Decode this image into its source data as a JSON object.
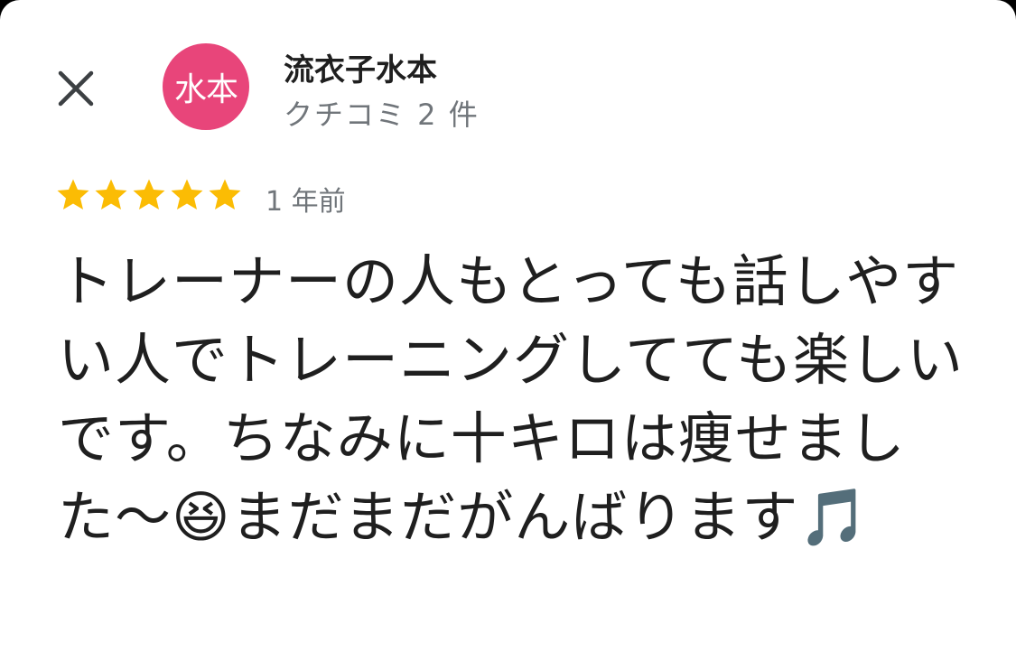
{
  "reviewer": {
    "name": "流衣子水本",
    "avatar_text": "水本",
    "review_count": "クチコミ 2 件",
    "avatar_color": "#e8457a"
  },
  "review": {
    "rating": 5,
    "max_rating": 5,
    "time": "1 年前",
    "text": "トレーナーの人もとっても話しやすい人でトレーニングしてても楽しいです。ちなみに十キロは痩せました〜😆まだまだがんばります🎵"
  },
  "colors": {
    "star": "#fbbc04",
    "secondary_text": "#70757a"
  },
  "icons": {
    "close": "close-icon",
    "star": "star-icon"
  }
}
